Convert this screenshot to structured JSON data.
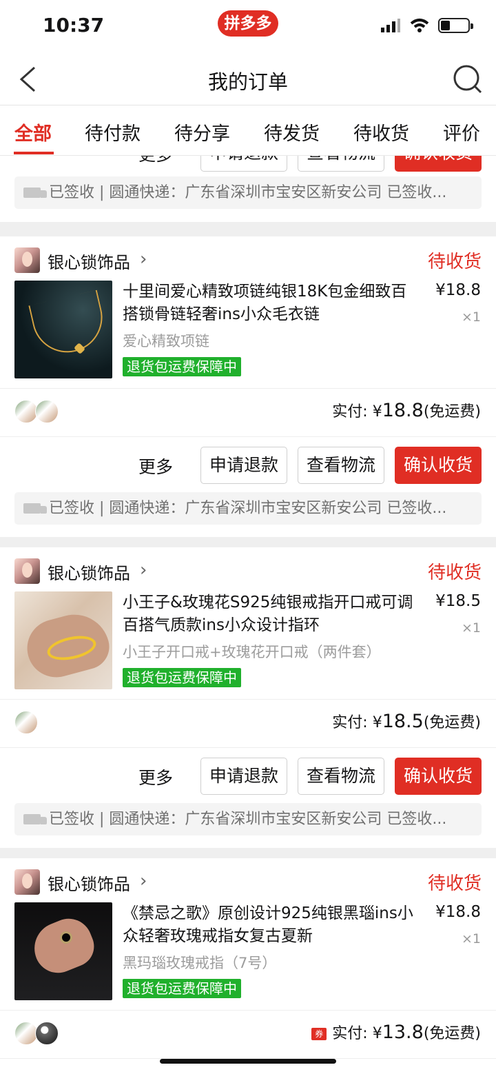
{
  "status": {
    "time": "10:37",
    "brand": "拼多多",
    "battery_level": 0.35
  },
  "header": {
    "title": "我的订单",
    "icons": [
      "back-icon",
      "search-icon"
    ]
  },
  "tabs": [
    {
      "label": "全部",
      "active": true
    },
    {
      "label": "待付款",
      "active": false
    },
    {
      "label": "待分享",
      "active": false
    },
    {
      "label": "待发货",
      "active": false
    },
    {
      "label": "待收货",
      "active": false
    },
    {
      "label": "评价",
      "active": false
    }
  ],
  "common": {
    "more": "更多",
    "refund": "申请退款",
    "logistics": "查看物流",
    "confirm": "确认收货",
    "delivery": "已签收 | 圆通快递：广东省深圳市宝安区新安公司 已签收...",
    "paid_label": "实付:",
    "currency": "¥",
    "free_shipping": "(免运费)",
    "coupon": "券"
  },
  "orders": [
    {
      "store": "银心锁饰品",
      "state": "待收货",
      "title": "十里间爱心精致项链纯银18K包金细致百搭锁骨链轻奢ins小众毛衣链",
      "price": "¥18.8",
      "quantity": "×1",
      "spec": "爱心精致项链",
      "badge": "退货包运费保障中",
      "paid": "18.8"
    },
    {
      "store": "银心锁饰品",
      "state": "待收货",
      "title": "小王子&玫瑰花S925纯银戒指开口戒可调百搭气质款ins小众设计指环",
      "price": "¥18.5",
      "quantity": "×1",
      "spec": "小王子开口戒+玫瑰花开口戒（两件套）",
      "badge": "退货包运费保障中",
      "paid": "18.5"
    },
    {
      "store": "银心锁饰品",
      "state": "待收货",
      "title": "《禁忌之歌》原创设计925纯银黑瑙ins小众轻奢玫瑰戒指女复古夏新",
      "price": "¥18.8",
      "quantity": "×1",
      "spec": "黑玛瑙玫瑰戒指（7号）",
      "badge": "退货包运费保障中",
      "paid": "13.8"
    }
  ]
}
